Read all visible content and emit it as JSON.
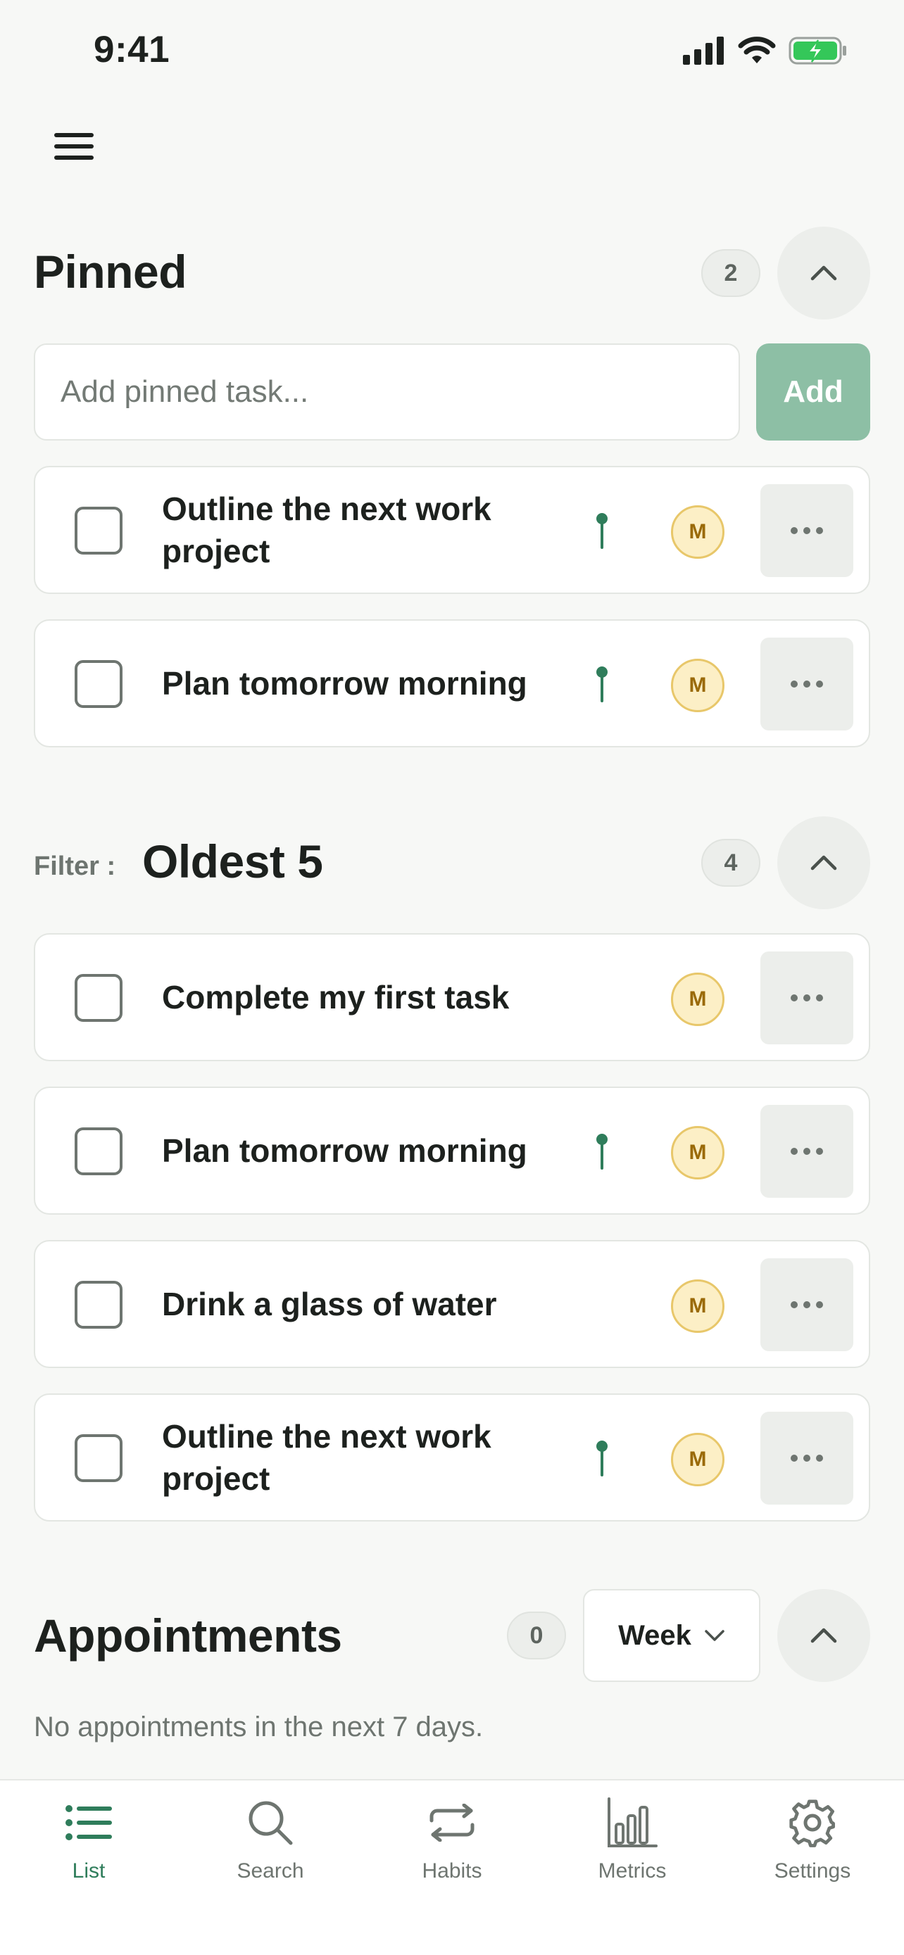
{
  "status_bar": {
    "time": "9:41"
  },
  "pinned": {
    "title": "Pinned",
    "count": "2",
    "input_placeholder": "Add pinned task...",
    "add_label": "Add",
    "tasks": [
      {
        "title": "Outline the next work project",
        "pinned": true,
        "avatar": "M"
      },
      {
        "title": "Plan tomorrow morning",
        "pinned": true,
        "avatar": "M"
      }
    ]
  },
  "filter": {
    "label": "Filter :",
    "title": "Oldest 5",
    "count": "4",
    "tasks": [
      {
        "title": "Complete my first task",
        "pinned": false,
        "avatar": "M"
      },
      {
        "title": "Plan tomorrow morning",
        "pinned": true,
        "avatar": "M"
      },
      {
        "title": "Drink a glass of water",
        "pinned": false,
        "avatar": "M"
      },
      {
        "title": "Outline the next work project",
        "pinned": true,
        "avatar": "M"
      }
    ]
  },
  "appointments": {
    "title": "Appointments",
    "count": "0",
    "range_label": "Week",
    "empty_text": "No appointments in the next 7 days."
  },
  "tab_bar": {
    "tabs": [
      {
        "label": "List",
        "icon": "list-icon",
        "active": true
      },
      {
        "label": "Search",
        "icon": "search-icon",
        "active": false
      },
      {
        "label": "Habits",
        "icon": "repeat-icon",
        "active": false
      },
      {
        "label": "Metrics",
        "icon": "bar-chart-icon",
        "active": false
      },
      {
        "label": "Settings",
        "icon": "gear-icon",
        "active": false
      }
    ]
  },
  "colors": {
    "background": "#f7f8f6",
    "accent_green": "#2f7d5b",
    "add_button": "#8dbfa5",
    "avatar_fill": "#fcefc6",
    "avatar_text": "#9a6a08",
    "battery_green": "#34c759"
  }
}
